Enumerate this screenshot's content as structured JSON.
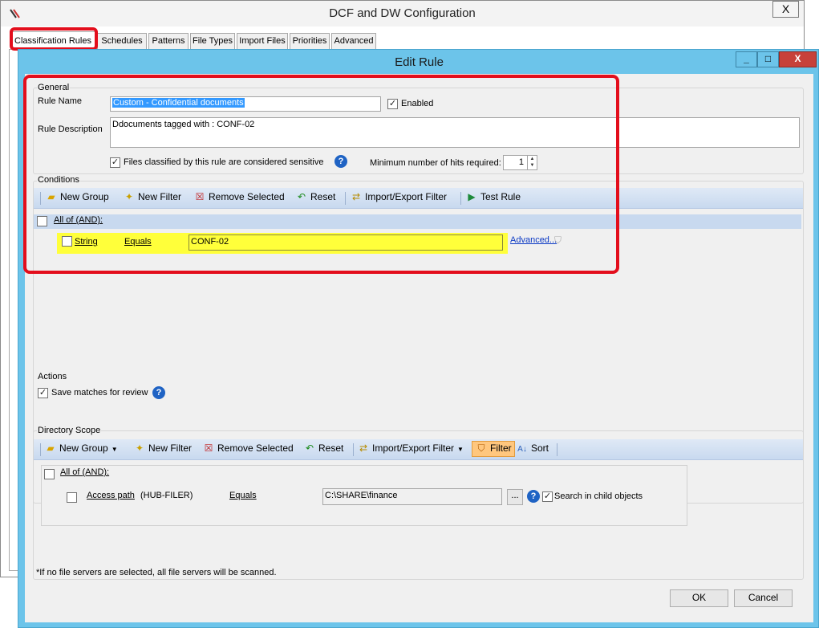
{
  "bg_window": {
    "title": "DCF and DW Configuration",
    "close_label": "X",
    "tabs": [
      "Classification Rules",
      "Schedules",
      "Patterns",
      "File Types",
      "Import Files",
      "Priorities",
      "Advanced"
    ],
    "active_tab": "Classification Rules"
  },
  "edit_window": {
    "title": "Edit Rule",
    "min_label": "_",
    "max_label": "□",
    "close_label": "X"
  },
  "general": {
    "group_label": "General",
    "rule_name_label": "Rule Name",
    "rule_name_value": "Custom - Confidential documents",
    "enabled_label": "Enabled",
    "enabled_checked": true,
    "rule_description_label": "Rule Description",
    "rule_description_value": "Ddocuments tagged with : CONF-02",
    "sensitive_label": "Files classified by this rule are considered sensitive",
    "sensitive_checked": true,
    "min_hits_label": "Minimum number of hits required:",
    "min_hits_value": "1"
  },
  "conditions": {
    "group_label": "Conditions",
    "toolbar": {
      "new_group": "New Group",
      "new_filter": "New Filter",
      "remove_selected": "Remove Selected",
      "reset": "Reset",
      "import_export": "Import/Export Filter",
      "test_rule": "Test Rule"
    },
    "root_label": "All of (AND):",
    "row": {
      "field": "String",
      "operator": "Equals",
      "value": "CONF-02",
      "advanced": "Advanced..."
    }
  },
  "actions": {
    "group_label": "Actions",
    "save_matches_label": "Save matches for review",
    "save_matches_checked": true
  },
  "directory_scope": {
    "group_label": "Directory Scope",
    "toolbar": {
      "new_group": "New Group",
      "new_filter": "New Filter",
      "remove_selected": "Remove Selected",
      "reset": "Reset",
      "import_export": "Import/Export Filter",
      "filter": "Filter",
      "sort": "Sort"
    },
    "root_label": "All of (AND):",
    "row": {
      "field": "Access path",
      "field_detail": "(HUB-FILER)",
      "operator": "Equals",
      "value": "C:\\SHARE\\finance",
      "browse": "...",
      "child_objects_label": "Search in child objects",
      "child_objects_checked": true
    },
    "footnote": "*If no file servers are selected, all file servers will be scanned."
  },
  "buttons": {
    "ok": "OK",
    "cancel": "Cancel"
  },
  "colors": {
    "highlight_red": "#e30e1c",
    "title_blue": "#6cc4ea",
    "condition_yellow": "#ffff3a"
  }
}
